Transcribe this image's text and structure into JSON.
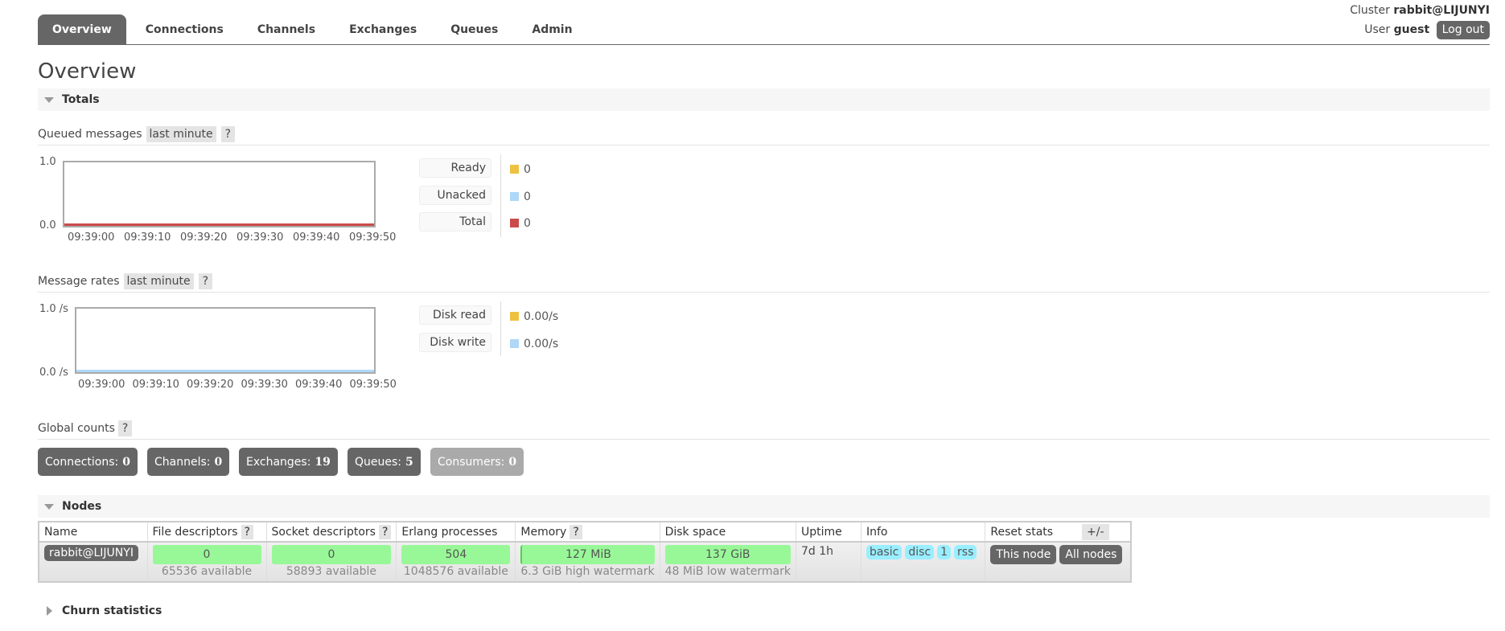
{
  "nav": {
    "tabs": [
      {
        "label": "Overview",
        "active": true
      },
      {
        "label": "Connections"
      },
      {
        "label": "Channels"
      },
      {
        "label": "Exchanges"
      },
      {
        "label": "Queues"
      },
      {
        "label": "Admin"
      }
    ]
  },
  "login": {
    "cluster_label": "Cluster",
    "cluster_name": "rabbit@LIJUNYI",
    "user_label": "User",
    "user_name": "guest",
    "logout_label": "Log out"
  },
  "page_title": "Overview",
  "totals": {
    "section_label": "Totals",
    "queued_messages": {
      "title": "Queued messages",
      "range_label": "last minute",
      "help_label": "?",
      "y_top": "1.0",
      "y_bottom": "0.0",
      "x_ticks": [
        "09:39:00",
        "09:39:10",
        "09:39:20",
        "09:39:30",
        "09:39:40",
        "09:39:50"
      ],
      "legend": [
        {
          "label": "Ready",
          "value": "0",
          "color": "#edc240"
        },
        {
          "label": "Unacked",
          "value": "0",
          "color": "#afd8f8"
        },
        {
          "label": "Total",
          "value": "0",
          "color": "#cb4b4b"
        }
      ]
    },
    "message_rates": {
      "title": "Message rates",
      "range_label": "last minute",
      "help_label": "?",
      "y_top": "1.0 /s",
      "y_bottom": "0.0 /s",
      "x_ticks": [
        "09:39:00",
        "09:39:10",
        "09:39:20",
        "09:39:30",
        "09:39:40",
        "09:39:50"
      ],
      "legend": [
        {
          "label": "Disk read",
          "value": "0.00/s",
          "color": "#edc240"
        },
        {
          "label": "Disk write",
          "value": "0.00/s",
          "color": "#afd8f8"
        }
      ]
    },
    "global_counts": {
      "title": "Global counts",
      "help_label": "?",
      "items": [
        {
          "label": "Connections:",
          "value": "0"
        },
        {
          "label": "Channels:",
          "value": "0"
        },
        {
          "label": "Exchanges:",
          "value": "19"
        },
        {
          "label": "Queues:",
          "value": "5"
        },
        {
          "label": "Consumers:",
          "value": "0",
          "disabled": true
        }
      ]
    }
  },
  "nodes": {
    "section_label": "Nodes",
    "columns": [
      "Name",
      "File descriptors",
      "Socket descriptors",
      "Erlang processes",
      "Memory",
      "Disk space",
      "Uptime",
      "Info",
      "Reset stats"
    ],
    "help_label": "?",
    "toggle_columns_label": "+/-",
    "rows": [
      {
        "name": "rabbit@LIJUNYI",
        "file_descriptors": {
          "value": "0",
          "sub": "65536 available"
        },
        "socket_descriptors": {
          "value": "0",
          "sub": "58893 available"
        },
        "erlang_processes": {
          "value": "504",
          "sub": "1048576 available"
        },
        "memory": {
          "value": "127 MiB",
          "sub": "6.3 GiB high watermark"
        },
        "disk_space": {
          "value": "137 GiB",
          "sub": "48 MiB low watermark"
        },
        "uptime": "7d 1h",
        "info_tags": [
          "basic",
          "disc",
          "1",
          "rss"
        ],
        "reset_buttons": [
          "This node",
          "All nodes"
        ]
      }
    ]
  },
  "churn": {
    "section_label": "Churn statistics"
  }
}
